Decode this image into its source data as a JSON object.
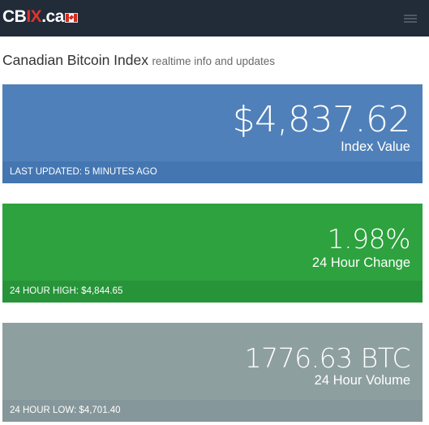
{
  "navbar": {
    "brand_prefix": "CB",
    "brand_highlight": "IX",
    "brand_suffix": ".ca",
    "flag_icon": "canada-flag-icon",
    "menu_icon": "hamburger-menu-icon",
    "colors": {
      "background": "#222b38",
      "highlight": "#e0352f"
    }
  },
  "heading": {
    "title": "Canadian Bitcoin Index",
    "subtitle": "realtime info and updates"
  },
  "panels": {
    "index": {
      "value": "$4,837.62",
      "label": "Index Value",
      "footer": "LAST UPDATED: 5 MINUTES AGO",
      "color": "#4f80b9"
    },
    "change": {
      "value": "1.98%",
      "label": "24 Hour Change",
      "footer": "24 HOUR HIGH: $4,844.65",
      "color": "#2da23e"
    },
    "volume": {
      "value": "1776.63 BTC",
      "label": "24 Hour Volume",
      "footer": "24 HOUR LOW: $4,701.40",
      "color": "#8e9fa0"
    }
  }
}
